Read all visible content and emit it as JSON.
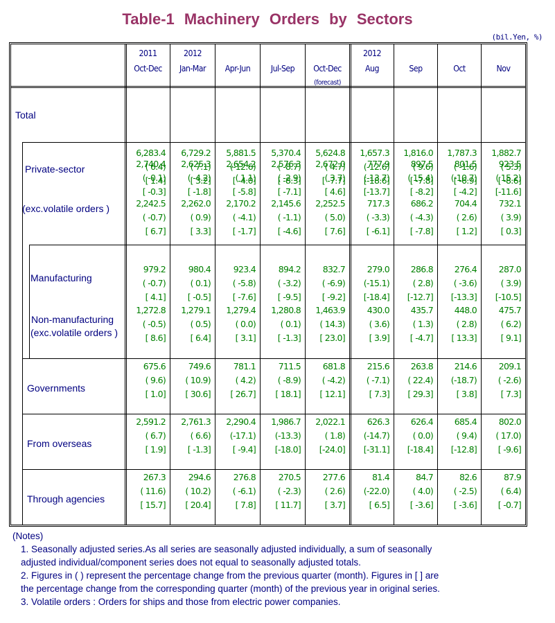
{
  "title": "Table-1   Machinery   Orders   by   Sectors",
  "unit": "(bil.Yen, %)",
  "columns": [
    {
      "line1": "2011",
      "line2": "Oct-Dec",
      "line3": ""
    },
    {
      "line1": "2012",
      "line2": "Jan-Mar",
      "line3": ""
    },
    {
      "line1": "",
      "line2": "Apr-Jun",
      "line3": ""
    },
    {
      "line1": "",
      "line2": "Jul-Sep",
      "line3": ""
    },
    {
      "line1": "",
      "line2": "Oct-Dec",
      "line3": "(forecast)"
    },
    {
      "line1": "2012",
      "line2": "Aug",
      "line3": ""
    },
    {
      "line1": "",
      "line2": "Sep",
      "line3": ""
    },
    {
      "line1": "",
      "line2": "Oct",
      "line3": ""
    },
    {
      "line1": "",
      "line2": "Nov",
      "line3": ""
    }
  ],
  "rows": [
    {
      "label": "Total",
      "values": [
        "6,283.4",
        "6,729.2",
        "5,881.5",
        "5,370.4",
        "5,624.8",
        "1,657.3",
        "1,816.0",
        "1,787.3",
        "1,882.7"
      ],
      "qoq": [
        "( 6.4)",
        "( 7.1)",
        "(-12.6)",
        "( -8.7)",
        "( 4.7)",
        "(-12.6)",
        "( 9.6)",
        "( -1.6)",
        "( 5.3)"
      ],
      "yoy": [
        "[ 1.4]",
        "[ 3.2]",
        "[ -4.0]",
        "[ -8.3]",
        "[ -7.7]",
        "[-18.6]",
        "[ -7.8]",
        "[ -6.9]",
        "[ -8.6]"
      ]
    },
    {
      "label": "Private-sector",
      "values": [
        "2,740.4",
        "2,625.3",
        "2,654.2",
        "2,576.3",
        "2,672.0",
        "777.9",
        "897.5",
        "801.5",
        "923.5"
      ],
      "qoq": [
        "( -0.1)",
        "( -4.2)",
        "( 1.1)",
        "( -2.9)",
        "( 3.7)",
        "(-13.7)",
        "( 15.4)",
        "(-10.7)",
        "( 15.2)"
      ],
      "yoy": [
        "[ -0.3]",
        "[ -1.8]",
        "[ -5.8]",
        "[ -7.1]",
        "[ 4.6]",
        "[-13.7]",
        "[ -8.2]",
        "[ -4.2]",
        "[-11.6]"
      ]
    },
    {
      "label": "(exc.volatile orders )",
      "values": [
        "2,242.5",
        "2,262.0",
        "2,170.2",
        "2,145.6",
        "2,252.5",
        "717.3",
        "686.2",
        "704.4",
        "732.1"
      ],
      "qoq": [
        "( -0.7)",
        "( 0.9)",
        "( -4.1)",
        "( -1.1)",
        "( 5.0)",
        "( -3.3)",
        "( -4.3)",
        "( 2.6)",
        "( 3.9)"
      ],
      "yoy": [
        "[ 6.7]",
        "[ 3.3]",
        "[ -1.7]",
        "[ -4.6]",
        "[ 7.6]",
        "[ -6.1]",
        "[ -7.8]",
        "[ 1.2]",
        "[ 0.3]"
      ]
    },
    {
      "label": "Manufacturing",
      "values": [
        "979.2",
        "980.4",
        "923.4",
        "894.2",
        "832.7",
        "279.0",
        "286.8",
        "276.4",
        "287.0"
      ],
      "qoq": [
        "( -0.7)",
        "( 0.1)",
        "( -5.8)",
        "( -3.2)",
        "( -6.9)",
        "(-15.1)",
        "( 2.8)",
        "( -3.6)",
        "( 3.9)"
      ],
      "yoy": [
        "[ 4.1]",
        "[ -0.5]",
        "[ -7.6]",
        "[ -9.5]",
        "[ -9.2]",
        "[-18.4]",
        "[-12.7]",
        "[-13.3]",
        "[-10.5]"
      ]
    },
    {
      "label": "Non-manufacturing",
      "label2": "(exc.volatile orders )",
      "values": [
        "1,272.8",
        "1,279.1",
        "1,279.4",
        "1,280.8",
        "1,463.9",
        "430.0",
        "435.7",
        "448.0",
        "475.7"
      ],
      "qoq": [
        "( -0.5)",
        "( 0.5)",
        "( 0.0)",
        "( 0.1)",
        "( 14.3)",
        "( 3.6)",
        "( 1.3)",
        "( 2.8)",
        "( 6.2)"
      ],
      "yoy": [
        "[ 8.6]",
        "[ 6.4]",
        "[ 3.1]",
        "[ -1.3]",
        "[ 23.0]",
        "[ 3.9]",
        "[ -4.7]",
        "[ 13.3]",
        "[ 9.1]"
      ]
    },
    {
      "label": "Governments",
      "values": [
        "675.6",
        "749.6",
        "781.1",
        "711.5",
        "681.8",
        "215.6",
        "263.8",
        "214.6",
        "209.1"
      ],
      "qoq": [
        "( 9.6)",
        "( 10.9)",
        "( 4.2)",
        "( -8.9)",
        "( -4.2)",
        "( -7.1)",
        "( 22.4)",
        "(-18.7)",
        "( -2.6)"
      ],
      "yoy": [
        "[ 1.0]",
        "[ 30.6]",
        "[ 26.7]",
        "[ 18.1]",
        "[ 12.1]",
        "[ 7.3]",
        "[ 29.3]",
        "[ 3.8]",
        "[ 7.3]"
      ]
    },
    {
      "label": "From overseas",
      "values": [
        "2,591.2",
        "2,761.3",
        "2,290.4",
        "1,986.7",
        "2,022.1",
        "626.3",
        "626.4",
        "685.4",
        "802.0"
      ],
      "qoq": [
        "( 6.7)",
        "( 6.6)",
        "(-17.1)",
        "(-13.3)",
        "( 1.8)",
        "(-14.7)",
        "( 0.0)",
        "( 9.4)",
        "( 17.0)"
      ],
      "yoy": [
        "[ 1.9]",
        "[ -1.3]",
        "[ -9.4]",
        "[-18.0]",
        "[-24.0]",
        "[-31.1]",
        "[-18.4]",
        "[-12.8]",
        "[ -9.6]"
      ]
    },
    {
      "label": "Through agencies",
      "values": [
        "267.3",
        "294.6",
        "276.8",
        "270.5",
        "277.6",
        "81.4",
        "84.7",
        "82.6",
        "87.9"
      ],
      "qoq": [
        "( 11.6)",
        "( 10.2)",
        "( -6.1)",
        "( -2.3)",
        "( 2.6)",
        "(-22.0)",
        "( 4.0)",
        "( -2.5)",
        "( 6.4)"
      ],
      "yoy": [
        "[ 15.7]",
        "[ 20.4]",
        "[ 7.8]",
        "[ 11.7]",
        "[ 3.7]",
        "[ 6.5]",
        "[ -3.6]",
        "[ -3.6]",
        "[ -0.7]"
      ]
    }
  ],
  "notes": {
    "heading": "(Notes)",
    "items": [
      "1. Seasonally adjusted series.As all series are seasonally adjusted individually, a sum of seasonally",
      "     adjusted individual/component series does not equal to seasonally adjusted totals.",
      "2. Figures in ( ) represent the percentage change from the previous quarter (month). Figures in [ ] are",
      "    the percentage change from the corresponding quarter (month) of the previous year in original series.",
      "3. Volatile orders : Orders for ships and those from electric power companies."
    ]
  }
}
